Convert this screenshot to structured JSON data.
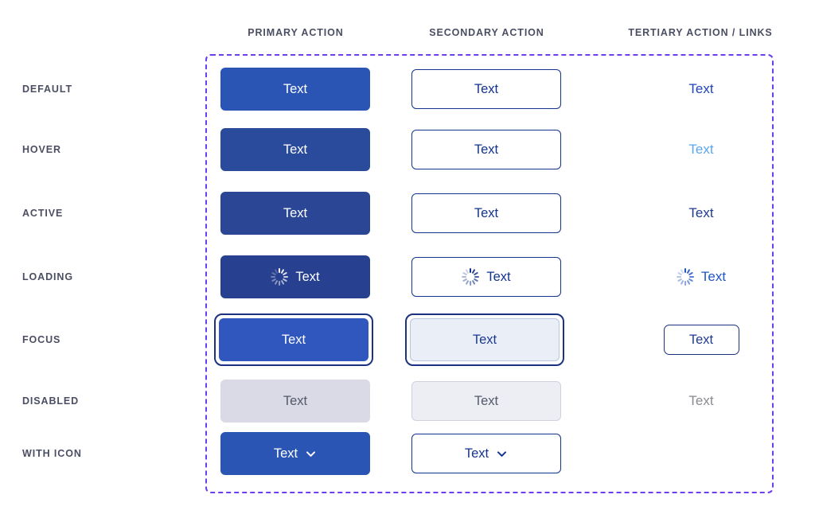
{
  "columns": [
    {
      "key": "primary",
      "label": "PRIMARY ACTION"
    },
    {
      "key": "secondary",
      "label": "SECONDARY ACTION"
    },
    {
      "key": "tertiary",
      "label": "TERTIARY ACTION / LINKS"
    }
  ],
  "rows": [
    {
      "key": "default",
      "label": "DEFAULT"
    },
    {
      "key": "hover",
      "label": "HOVER"
    },
    {
      "key": "active",
      "label": "ACTIVE"
    },
    {
      "key": "loading",
      "label": "LOADING"
    },
    {
      "key": "focus",
      "label": "FOCUS"
    },
    {
      "key": "disabled",
      "label": "DISABLED"
    },
    {
      "key": "withicon",
      "label": "WITH ICON"
    }
  ],
  "buttons": {
    "primary": {
      "default": {
        "label": "Text"
      },
      "hover": {
        "label": "Text"
      },
      "active": {
        "label": "Text"
      },
      "loading": {
        "label": "Text",
        "icon": "spinner-icon"
      },
      "focus": {
        "label": "Text"
      },
      "disabled": {
        "label": "Text"
      },
      "withicon": {
        "label": "Text",
        "icon": "chevron-down-icon"
      }
    },
    "secondary": {
      "default": {
        "label": "Text"
      },
      "hover": {
        "label": "Text"
      },
      "active": {
        "label": "Text"
      },
      "loading": {
        "label": "Text",
        "icon": "spinner-icon"
      },
      "focus": {
        "label": "Text"
      },
      "disabled": {
        "label": "Text"
      },
      "withicon": {
        "label": "Text",
        "icon": "chevron-down-icon"
      }
    },
    "tertiary": {
      "default": {
        "label": "Text"
      },
      "hover": {
        "label": "Text"
      },
      "active": {
        "label": "Text"
      },
      "loading": {
        "label": "Text",
        "icon": "spinner-icon"
      },
      "focus": {
        "label": "Text"
      },
      "disabled": {
        "label": "Text"
      },
      "withicon": {
        "label": ""
      }
    }
  },
  "colors": {
    "primary_default": "#2B55B5",
    "primary_hover": "#2A4A9B",
    "primary_active": "#2A4694",
    "primary_loading": "#27408F",
    "primary_focus_fill": "#3057BD",
    "primary_disabled_fill": "#D9DAE5",
    "disabled_text": "#54586B",
    "secondary_border": "#13348C",
    "secondary_focus_fill": "#E9EEF7",
    "secondary_disabled_fill": "#ECEEF3",
    "tertiary_default": "#1F44BA",
    "tertiary_hover": "#5BA7EE",
    "tertiary_active": "#1F3B8F",
    "tertiary_disabled": "#8A8A90",
    "focus_ring": "#1B3280",
    "frame_dashed": "#6B3FEF",
    "label_text": "#4B4E63",
    "background": "#FFFFFF"
  }
}
